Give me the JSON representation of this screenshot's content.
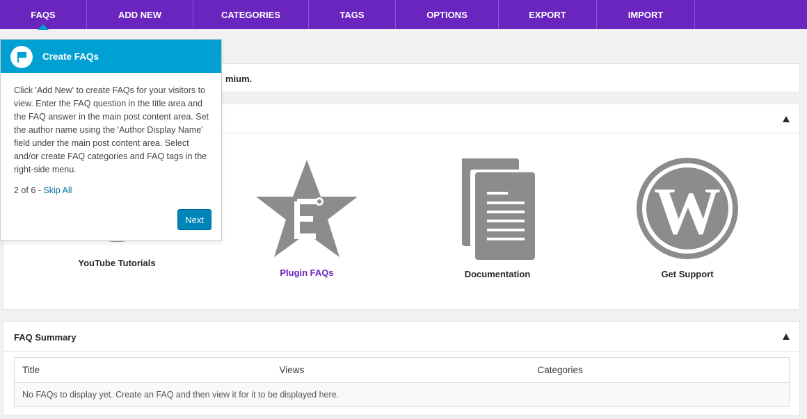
{
  "nav": {
    "tabs": [
      {
        "label": "FAQS"
      },
      {
        "label": "ADD NEW"
      },
      {
        "label": "CATEGORIES"
      },
      {
        "label": "TAGS"
      },
      {
        "label": "OPTIONS"
      },
      {
        "label": "EXPORT"
      },
      {
        "label": "IMPORT"
      }
    ]
  },
  "notice": {
    "visible_text": "mium."
  },
  "resources": {
    "items": [
      {
        "label": "YouTube Tutorials",
        "icon": "youtube-icon"
      },
      {
        "label": "Plugin FAQs",
        "icon": "star-icon"
      },
      {
        "label": "Documentation",
        "icon": "document-icon"
      },
      {
        "label": "Get Support",
        "icon": "wordpress-icon"
      }
    ]
  },
  "summary": {
    "title": "FAQ Summary",
    "columns": [
      "Title",
      "Views",
      "Categories"
    ],
    "empty_message": "No FAQs to display yet. Create an FAQ and then view it for it to be displayed here."
  },
  "pointer": {
    "title": "Create FAQs",
    "body": "Click 'Add New' to create FAQs for your visitors to view. Enter the FAQ question in the title area and the FAQ answer in the main post content area. Set the author name using the 'Author Display Name' field under the main post content area. Select and/or create FAQ categories and FAQ tags in the right-side menu.",
    "step": "2 of 6 - ",
    "skip_label": "Skip All",
    "next_label": "Next"
  },
  "colors": {
    "nav_bg": "#6a25bf",
    "pointer_accent": "#00a0d2",
    "button": "#0085ba",
    "link": "#0073aa",
    "icon_gray": "#8c8c8c"
  }
}
